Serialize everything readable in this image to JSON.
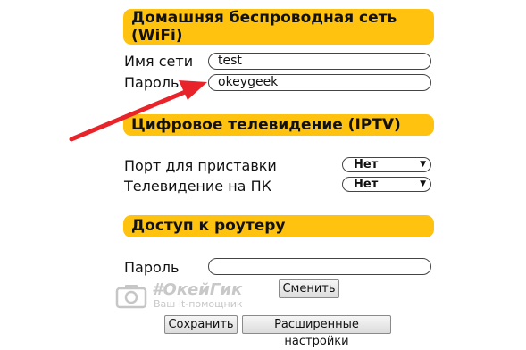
{
  "wifi": {
    "header": "Домашняя беспроводная сеть (WiFi)",
    "ssid_label": "Имя сети",
    "ssid_value": "test",
    "password_label": "Пароль",
    "password_value": "okeygeek"
  },
  "iptv": {
    "header": "Цифровое телевидение (IPTV)",
    "stb_port_label": "Порт для приставки",
    "stb_port_value": "Нет",
    "pc_tv_label": "Телевидение на ПК",
    "pc_tv_value": "Нет"
  },
  "router_access": {
    "header": "Доступ к роутеру",
    "password_label": "Пароль",
    "password_value": "",
    "change_button": "Сменить"
  },
  "actions": {
    "save_button": "Сохранить",
    "advanced_button": "Расширенные настройки"
  },
  "watermark": {
    "title": "#ОкейГик",
    "subtitle": "Ваш it-помощник"
  },
  "colors": {
    "header_bg": "#ffc20e",
    "arrow": "#e8232a"
  },
  "icons": {
    "dropdown": "triangle-down",
    "watermark": "camera-icon"
  }
}
